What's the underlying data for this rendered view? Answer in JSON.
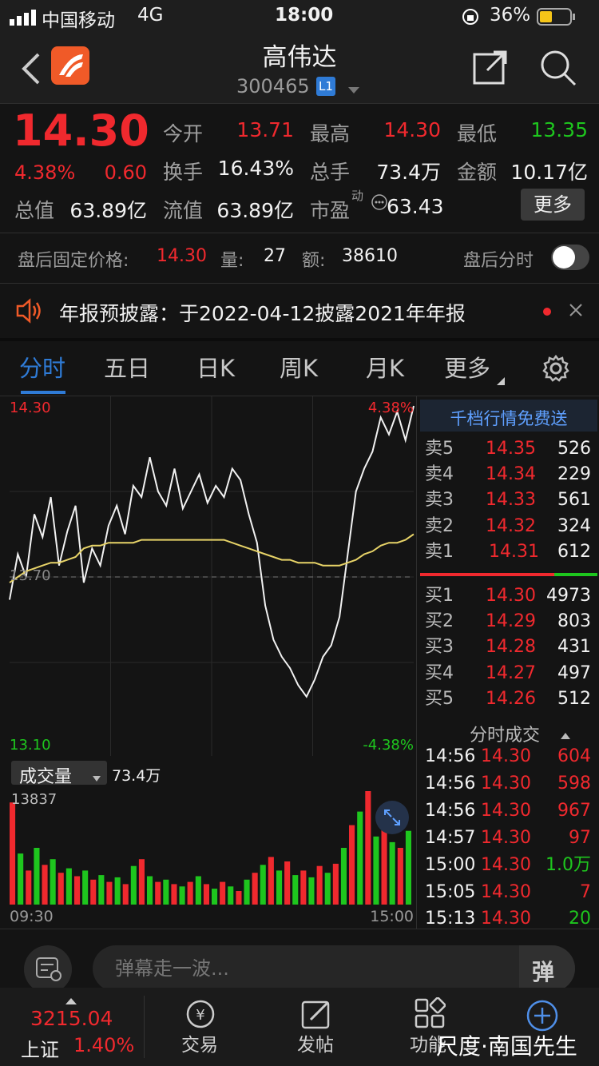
{
  "status_bar": {
    "carrier": "中国移动",
    "network": "4G",
    "time": "18:00",
    "battery": "36%"
  },
  "header": {
    "title": "高伟达",
    "code": "300465",
    "level_badge": "L1",
    "app_icon": "app-logo-icon"
  },
  "quote": {
    "price": "14.30",
    "change_pct": "4.38%",
    "change": "0.60",
    "open_label": "今开",
    "open": "13.71",
    "high_label": "最高",
    "high": "14.30",
    "low_label": "最低",
    "low": "13.35",
    "turnover_label": "换手",
    "turnover": "16.43%",
    "volume_label": "总手",
    "volume": "73.4万",
    "amount_label": "金额",
    "amount": "10.17亿",
    "mktcap_label": "总值",
    "mktcap": "63.89亿",
    "float_label": "流值",
    "float": "63.89亿",
    "pe_label": "市盈",
    "pe_sup": "动",
    "pe": "63.43",
    "more_button": "更多"
  },
  "after_hours": {
    "price_label": "盘后固定价格:",
    "price": "14.30",
    "vol_label": "量:",
    "vol": "27",
    "amt_label": "额:",
    "amt": "38610",
    "toggle_label": "盘后分时",
    "toggle_on": false
  },
  "notice": {
    "text": "年报预披露：于2022-04-12披露2021年年报"
  },
  "tabs": [
    {
      "label": "分时",
      "active": true
    },
    {
      "label": "五日",
      "active": false
    },
    {
      "label": "日K",
      "active": false
    },
    {
      "label": "周K",
      "active": false
    },
    {
      "label": "月K",
      "active": false
    },
    {
      "label": "更多",
      "active": false
    }
  ],
  "chart_labels": {
    "top_price": "14.30",
    "bottom_price": "13.10",
    "top_pct": "4.38%",
    "bottom_pct": "-4.38%",
    "mid_price": "13.70",
    "vol_selector": "成交量",
    "vol_total": "73.4万",
    "vol_max": "13837",
    "time_start": "09:30",
    "time_end": "15:00"
  },
  "chart_data": {
    "type": "line",
    "x_range": [
      "09:30",
      "15:00"
    ],
    "ylim": [
      13.1,
      14.3
    ],
    "reference": 13.7,
    "series": [
      {
        "values": [
          13.62,
          13.78,
          13.7,
          13.92,
          13.84,
          13.98,
          13.74,
          13.86,
          13.95,
          13.68,
          13.8,
          13.74,
          13.88,
          13.95,
          13.85,
          14.02,
          13.98,
          14.12,
          14.0,
          13.95,
          14.08,
          13.94,
          14.0,
          14.06,
          13.96,
          14.02,
          13.98,
          14.08,
          14.04,
          13.92,
          13.82,
          13.6,
          13.48,
          13.42,
          13.38,
          13.32,
          13.28,
          13.34,
          13.42,
          13.46,
          13.56,
          13.78,
          14.0,
          14.08,
          14.14,
          14.26,
          14.2,
          14.28,
          14.18,
          14.3
        ]
      },
      {
        "values": [
          13.68,
          13.7,
          13.72,
          13.73,
          13.74,
          13.75,
          13.75,
          13.76,
          13.77,
          13.8,
          13.81,
          13.81,
          13.82,
          13.82,
          13.82,
          13.82,
          13.83,
          13.83,
          13.83,
          13.83,
          13.83,
          13.83,
          13.83,
          13.83,
          13.83,
          13.83,
          13.83,
          13.82,
          13.81,
          13.8,
          13.79,
          13.78,
          13.77,
          13.76,
          13.76,
          13.75,
          13.75,
          13.75,
          13.74,
          13.74,
          13.74,
          13.75,
          13.76,
          13.78,
          13.79,
          13.81,
          13.82,
          13.82,
          13.83,
          13.85
        ]
      }
    ],
    "volume": [
      0.9,
      0.45,
      0.3,
      0.5,
      0.35,
      0.4,
      0.28,
      0.32,
      0.25,
      0.3,
      0.22,
      0.26,
      0.2,
      0.24,
      0.18,
      0.34,
      0.4,
      0.25,
      0.2,
      0.22,
      0.18,
      0.16,
      0.2,
      0.25,
      0.18,
      0.14,
      0.2,
      0.16,
      0.12,
      0.22,
      0.28,
      0.35,
      0.42,
      0.3,
      0.38,
      0.26,
      0.3,
      0.24,
      0.34,
      0.28,
      0.36,
      0.5,
      0.7,
      0.82,
      1.0,
      0.6,
      0.75,
      0.55,
      0.5,
      0.65
    ],
    "volume_colors": [
      "red",
      "green"
    ]
  },
  "orderbook": {
    "promo": "千档行情免费送",
    "asks": [
      {
        "label": "卖5",
        "price": "14.35",
        "vol": "526"
      },
      {
        "label": "卖4",
        "price": "14.34",
        "vol": "229"
      },
      {
        "label": "卖3",
        "price": "14.33",
        "vol": "561"
      },
      {
        "label": "卖2",
        "price": "14.32",
        "vol": "324"
      },
      {
        "label": "卖1",
        "price": "14.31",
        "vol": "612"
      }
    ],
    "bids": [
      {
        "label": "买1",
        "price": "14.30",
        "vol": "4973"
      },
      {
        "label": "买2",
        "price": "14.29",
        "vol": "803"
      },
      {
        "label": "买3",
        "price": "14.28",
        "vol": "431"
      },
      {
        "label": "买4",
        "price": "14.27",
        "vol": "497"
      },
      {
        "label": "买5",
        "price": "14.26",
        "vol": "512"
      }
    ],
    "ticks_title": "分时成交",
    "ticks": [
      {
        "time": "14:56",
        "price": "14.30",
        "vol": "604",
        "dir": "red"
      },
      {
        "time": "14:56",
        "price": "14.30",
        "vol": "598",
        "dir": "red"
      },
      {
        "time": "14:56",
        "price": "14.30",
        "vol": "967",
        "dir": "red"
      },
      {
        "time": "14:57",
        "price": "14.30",
        "vol": "97",
        "dir": "red"
      },
      {
        "time": "15:00",
        "price": "14.30",
        "vol": "1.0万",
        "dir": "green"
      },
      {
        "time": "15:05",
        "price": "14.30",
        "vol": "7",
        "dir": "red"
      },
      {
        "time": "15:13",
        "price": "14.30",
        "vol": "20",
        "dir": "green"
      }
    ]
  },
  "comment_bar": {
    "placeholder": "弹幕走一波...",
    "danmaku_button": "弹"
  },
  "bottom_bar": {
    "index_value": "3215.04",
    "index_name": "上证",
    "index_pct": "1.40%",
    "trade": "交易",
    "post": "发帖",
    "func": "功能",
    "watermark": "尺度·南国先生"
  },
  "colors": {
    "up": "#f0292e",
    "down": "#1ec61e",
    "accent": "#2f7bd6",
    "avg_line": "#e8d468"
  }
}
